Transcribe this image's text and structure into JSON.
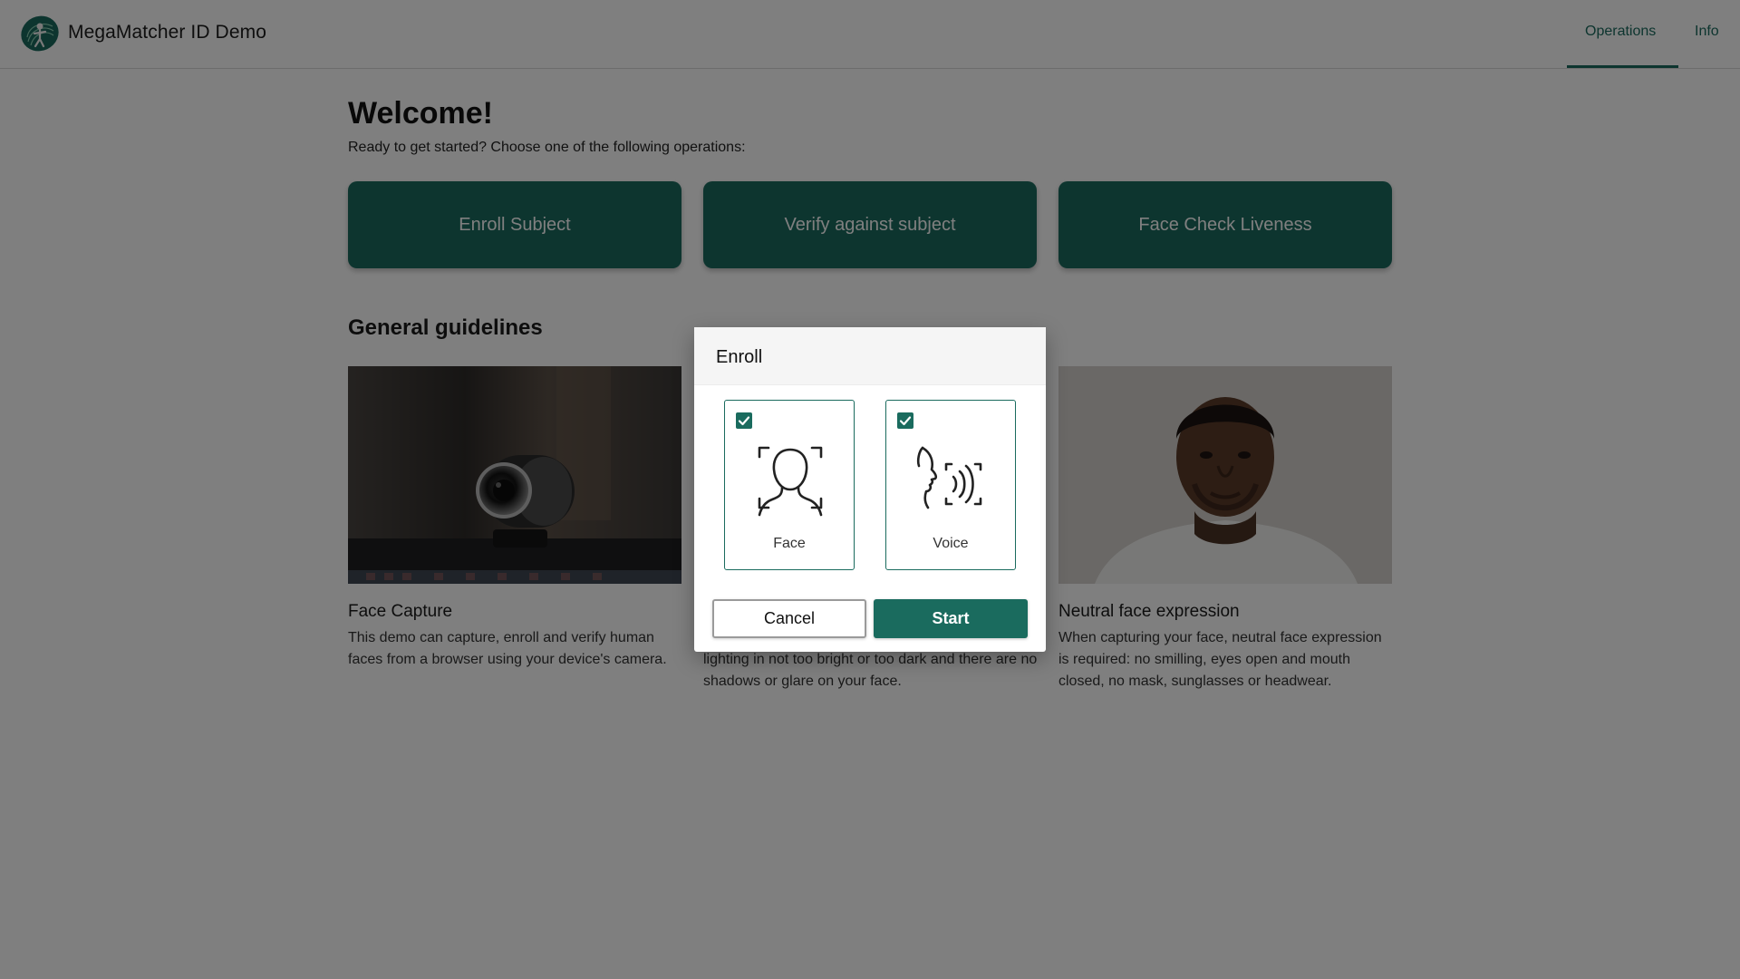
{
  "header": {
    "app_title": "MegaMatcher ID Demo",
    "logo_icon": "fingerprint-person-logo-icon",
    "nav": [
      {
        "label": "Operations",
        "active": true
      },
      {
        "label": "Info",
        "active": false
      }
    ]
  },
  "main": {
    "welcome": "Welcome!",
    "subtitle": "Ready to get started? Choose one of the following operations:",
    "operations": [
      {
        "label": "Enroll Subject"
      },
      {
        "label": "Verify against subject"
      },
      {
        "label": "Face Check Liveness"
      }
    ],
    "guidelines_title": "General guidelines",
    "cards": [
      {
        "title": "Face Capture",
        "text": "This demo can capture, enroll and verify human faces from a browser using your device's camera."
      },
      {
        "title": "",
        "text": "lighting in not too bright or too dark and there are no shadows or glare on your face."
      },
      {
        "title": "Neutral face expression",
        "text": "When capturing your face, neutral face expression is required: no smilling, eyes open and mouth closed, no mask, sunglasses or headwear."
      }
    ]
  },
  "dialog": {
    "title": "Enroll",
    "modalities": [
      {
        "label": "Face",
        "checked": true,
        "icon": "face-scan-icon"
      },
      {
        "label": "Voice",
        "checked": true,
        "icon": "voice-scan-icon"
      }
    ],
    "cancel_label": "Cancel",
    "start_label": "Start"
  },
  "colors": {
    "accent": "#1a6b5e",
    "overlay": "rgba(0,0,0,0.5)"
  }
}
